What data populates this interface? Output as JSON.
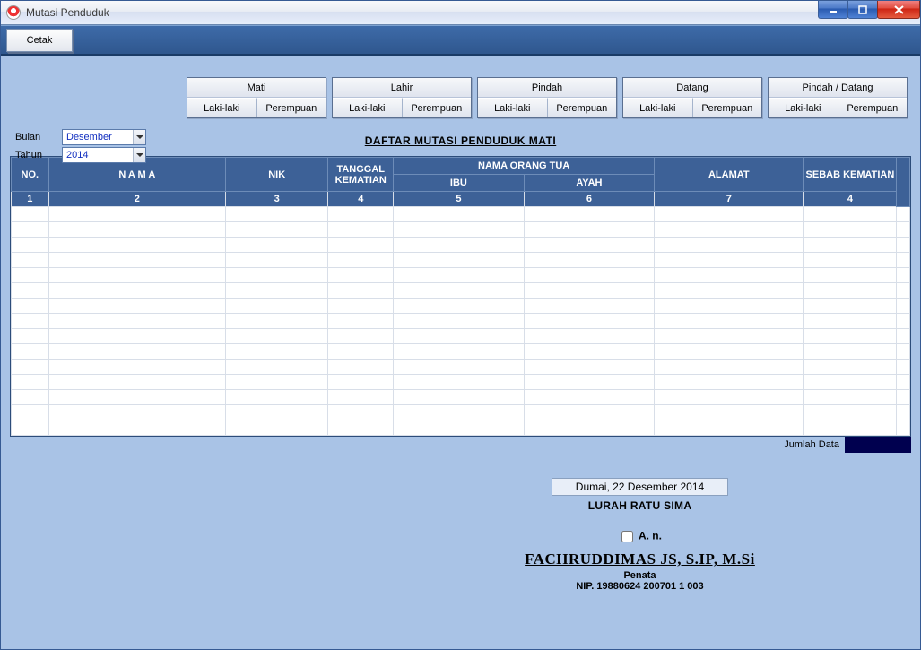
{
  "window": {
    "title": "Mutasi Penduduk"
  },
  "toolbar": {
    "cetak": "Cetak"
  },
  "categories": [
    {
      "title": "Mati",
      "sub": [
        "Laki-laki",
        "Perempuan"
      ]
    },
    {
      "title": "Lahir",
      "sub": [
        "Laki-laki",
        "Perempuan"
      ]
    },
    {
      "title": "Pindah",
      "sub": [
        "Laki-laki",
        "Perempuan"
      ]
    },
    {
      "title": "Datang",
      "sub": [
        "Laki-laki",
        "Perempuan"
      ]
    },
    {
      "title": "Pindah / Datang",
      "sub": [
        "Laki-laki",
        "Perempuan"
      ]
    }
  ],
  "filters": {
    "bulan_label": "Bulan",
    "bulan_value": "Desember",
    "tahun_label": "Tahun",
    "tahun_value": "2014"
  },
  "page_title": "DAFTAR MUTASI PENDUDUK MATI",
  "table": {
    "headers": {
      "no": "NO.",
      "nama": "N A M A",
      "nik": "NIK",
      "tgl": "TANGGAL KEMATIAN",
      "ortu": "NAMA ORANG TUA",
      "ibu": "IBU",
      "ayah": "AYAH",
      "alamat": "ALAMAT",
      "sebab": "SEBAB KEMATIAN"
    },
    "col_numbers": [
      "1",
      "2",
      "3",
      "4",
      "5",
      "6",
      "7",
      "4"
    ]
  },
  "footer": {
    "jumlah_label": "Jumlah Data",
    "jumlah_value": "",
    "tempat_tanggal": "Dumai, 22 Desember 2014",
    "jabatan": "LURAH RATU SIMA",
    "an_label": "A. n.",
    "signer": "FACHRUDDIMAS JS, S.IP, M.Si",
    "rank": "Penata",
    "nip": "NIP. 19880624 200701 1 003"
  }
}
